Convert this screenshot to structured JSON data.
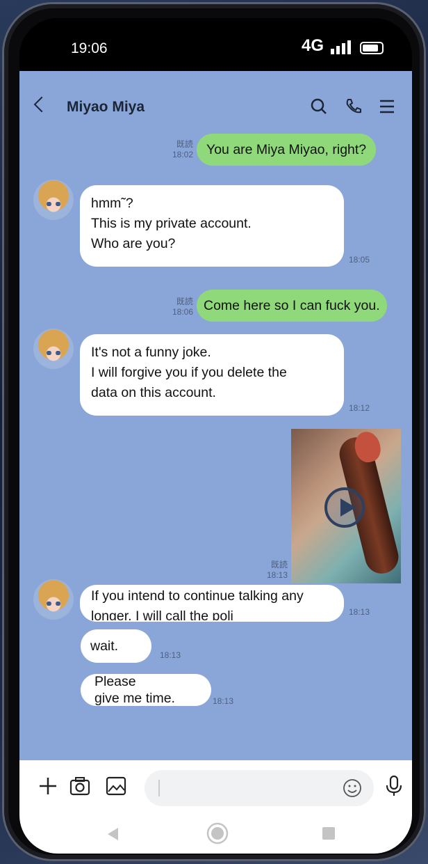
{
  "status_bar": {
    "time": "19:06",
    "network": "4G"
  },
  "header": {
    "contact_name": "Miyao Miya"
  },
  "messages": [
    {
      "side": "out",
      "text": "You are Miya Miyao, right?",
      "read": "既読",
      "time": "18:02"
    },
    {
      "side": "in",
      "lines": [
        "hmm˜?",
        "This is my private account.",
        "Who are you?"
      ],
      "time": "18:05"
    },
    {
      "side": "out",
      "text": "Come here so I can fuck you.",
      "read": "既読",
      "time": "18:06"
    },
    {
      "side": "in",
      "lines": [
        "It's not a funny joke.",
        "I will forgive you if you delete the",
        "data on this account."
      ],
      "time": "18:12"
    },
    {
      "side": "out",
      "type": "video",
      "read": "既読",
      "time": "18:13"
    },
    {
      "side": "in",
      "lines": [
        "If you intend to continue talking any",
        "longer, I will call the poli"
      ],
      "time": "18:13"
    },
    {
      "side": "in",
      "lines": [
        "wait."
      ],
      "time": "18:13"
    },
    {
      "side": "in",
      "lines": [
        "Please",
        "give me time."
      ],
      "time": "18:13"
    }
  ],
  "colors": {
    "chat_background": "#8aa6d8",
    "outgoing_bubble": "#8fd97a",
    "incoming_bubble": "#ffffff"
  },
  "icons": {
    "header": [
      "back-icon",
      "search-icon",
      "phone-icon",
      "menu-icon"
    ],
    "input_bar": [
      "plus-icon",
      "camera-icon",
      "image-icon",
      "emoji-icon",
      "microphone-icon"
    ],
    "nav_bar": [
      "back-triangle-icon",
      "home-circle-icon",
      "recents-square-icon"
    ]
  }
}
